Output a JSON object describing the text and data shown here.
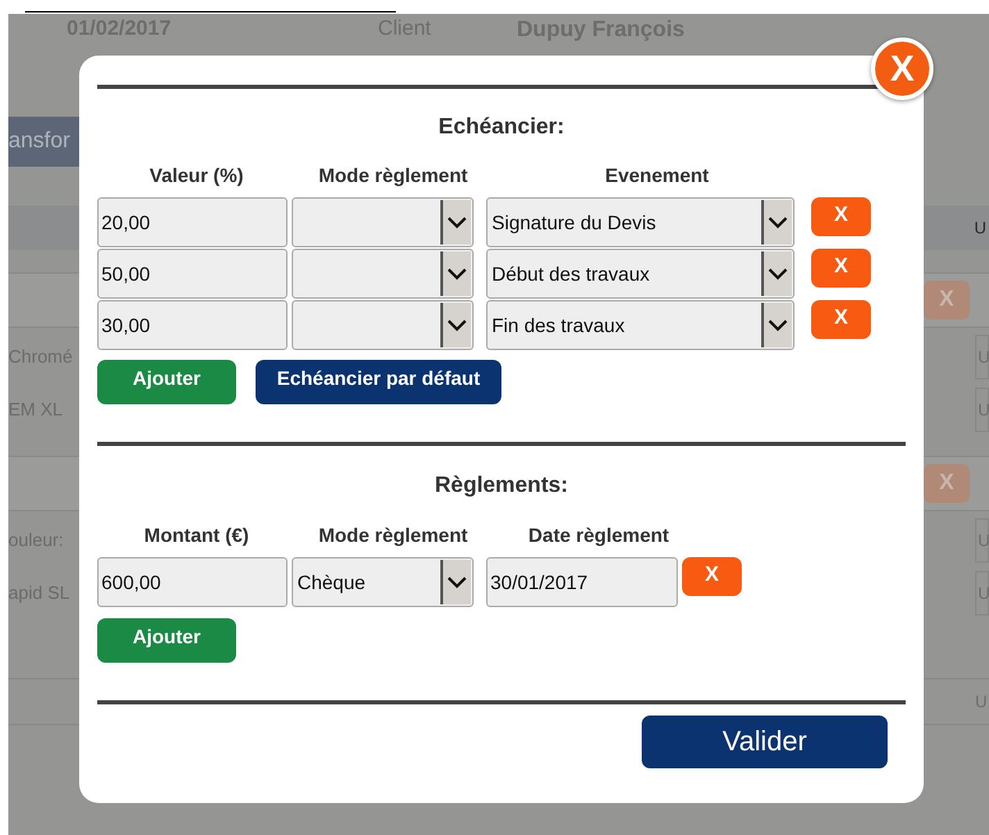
{
  "background": {
    "header": {
      "date": "01/02/2017",
      "client_label": "Client",
      "client_name": "Dupuy François"
    },
    "tab": "ansfor",
    "top_unit": "U",
    "sections": [
      {
        "remove": "X",
        "lines": [
          {
            "text": "Chromé",
            "unit": "U"
          },
          {
            "text": "EM XL",
            "unit": "U"
          }
        ]
      },
      {
        "remove": "X",
        "lines": [
          {
            "text": "ouleur:",
            "unit": "U"
          },
          {
            "text": "apid SL",
            "unit": "U"
          }
        ]
      }
    ],
    "last_unit": "U"
  },
  "dialog": {
    "close": "X",
    "schedule": {
      "title": "Echéancier:",
      "columns": [
        "Valeur (%)",
        "Mode règlement",
        "Evenement"
      ],
      "rows": [
        {
          "value": "20,00",
          "mode": "",
          "event": "Signature du Devis",
          "remove": "X"
        },
        {
          "value": "50,00",
          "mode": "",
          "event": "Début des travaux",
          "remove": "X"
        },
        {
          "value": "30,00",
          "mode": "",
          "event": "Fin des travaux",
          "remove": "X"
        }
      ],
      "add_button": "Ajouter",
      "default_button": "Echéancier par défaut"
    },
    "payments": {
      "title": "Règlements:",
      "columns": [
        "Montant (€)",
        "Mode règlement",
        "Date règlement"
      ],
      "rows": [
        {
          "amount": "600,00",
          "mode": "Chèque",
          "date": "30/01/2017",
          "remove": "X"
        }
      ],
      "add_button": "Ajouter"
    },
    "submit": "Valider"
  }
}
